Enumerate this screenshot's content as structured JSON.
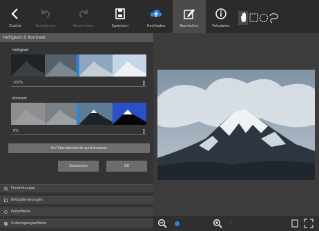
{
  "toolbar": {
    "buttons": [
      {
        "label": "Zurück",
        "icon": "back-icon",
        "disabled": false
      },
      {
        "label": "Rückgängig",
        "icon": "undo-icon",
        "disabled": true
      },
      {
        "label": "Wiederholen",
        "icon": "redo-icon",
        "disabled": true
      },
      {
        "label": "Speichern",
        "icon": "save-icon",
        "disabled": false
      },
      {
        "label": "Hochladen",
        "icon": "cloud-upload-icon",
        "disabled": false
      },
      {
        "label": "Bearbeiten",
        "icon": "edit-icon",
        "disabled": false,
        "selected": true
      },
      {
        "label": "Fotodaten",
        "icon": "info-icon",
        "disabled": false
      }
    ],
    "tools": [
      "hand-tool-icon",
      "rect-select-icon",
      "ellipse-select-icon",
      "lasso-select-icon"
    ],
    "accent": "#2e84d6"
  },
  "panel": {
    "header": "Helligkeit & Kontrast",
    "brightness": {
      "label": "Helligkeit",
      "value": "100%"
    },
    "contrast": {
      "label": "Kontrast",
      "value": "0%"
    },
    "reset_label": "Auf Standardwerte zurücksetzen",
    "cancel_label": "Abbrechen",
    "ok_label": "OK",
    "list": [
      {
        "label": "Freistellungen",
        "icon": "crop-icon"
      },
      {
        "label": "Bildoptimierungen",
        "icon": "enhance-icon"
      },
      {
        "label": "Farbeffekte",
        "icon": "color-effects-icon"
      },
      {
        "label": "Unterlegungseffekte",
        "icon": "overlay-effects-icon"
      }
    ]
  },
  "bottombar": {
    "zoom_out": "zoom-out-icon",
    "zoom_in": "zoom-in-icon",
    "pager": "1",
    "icons": [
      "fit-screen-icon",
      "fullscreen-icon"
    ]
  }
}
